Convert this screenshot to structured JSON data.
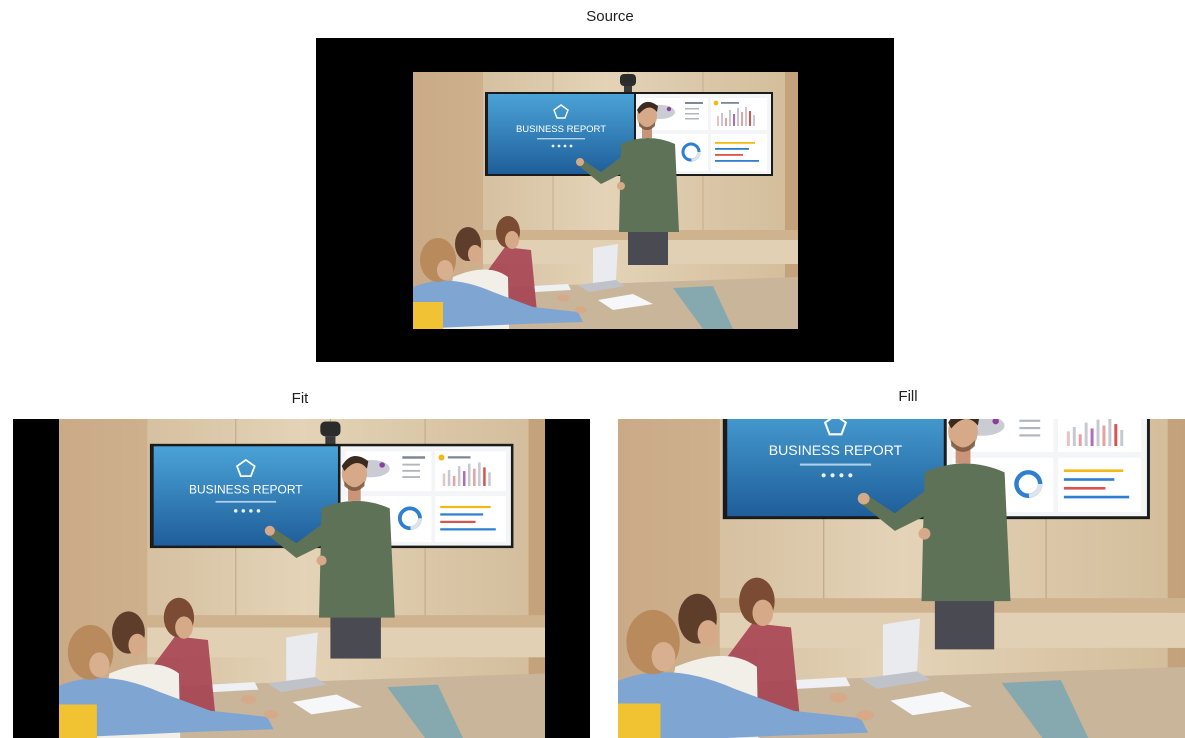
{
  "labels": {
    "source": "Source",
    "fit": "Fit",
    "fill": "Fill"
  },
  "screen": {
    "title": "BUSINESS REPORT",
    "subtitle": "",
    "icon": "pentagon-icon"
  },
  "colors": {
    "background": "#ffffff",
    "letterbox": "#000000",
    "wall": "#dcc7a8",
    "slide_blue": "#2f78b8",
    "shirt": "#5d7256"
  }
}
